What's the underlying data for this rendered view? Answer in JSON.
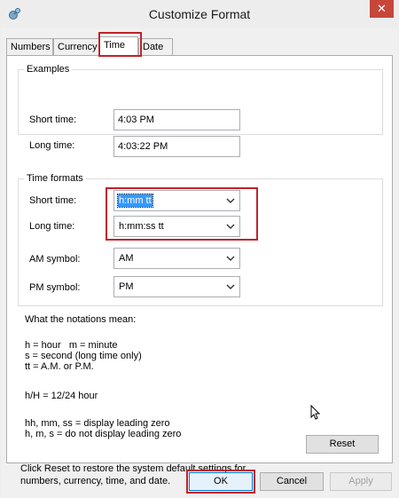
{
  "window": {
    "title": "Customize Format",
    "close_symbol": "✕"
  },
  "tabs": [
    {
      "label": "Numbers",
      "active": false
    },
    {
      "label": "Currency",
      "active": false
    },
    {
      "label": "Time",
      "active": true
    },
    {
      "label": "Date",
      "active": false
    }
  ],
  "examples": {
    "legend": "Examples",
    "short_time_label": "Short time:",
    "short_time_value": "4:03 PM",
    "long_time_label": "Long time:",
    "long_time_value": "4:03:22 PM"
  },
  "time_formats": {
    "legend": "Time formats",
    "short_time_label": "Short time:",
    "short_time_value": "h:mm tt",
    "long_time_label": "Long time:",
    "long_time_value": "h:mm:ss tt",
    "am_label": "AM symbol:",
    "am_value": "AM",
    "pm_label": "PM symbol:",
    "pm_value": "PM"
  },
  "notations": {
    "heading": "What the notations mean:",
    "line1": "h = hour   m = minute",
    "line2": "s = second (long time only)",
    "line3": "tt = A.M. or P.M.",
    "line4": "h/H = 12/24 hour",
    "line5": "hh, mm, ss = display leading zero",
    "line6": "h, m, s = do not display leading zero"
  },
  "reset": {
    "text_line1": "Click Reset to restore the system default settings for",
    "text_line2": "numbers, currency, time, and date.",
    "button_label": "Reset"
  },
  "buttons": {
    "ok": "OK",
    "cancel": "Cancel",
    "apply": "Apply"
  },
  "colors": {
    "highlight_box": "#c1222a",
    "selection": "#3399ff",
    "close_button": "#c7463a"
  }
}
